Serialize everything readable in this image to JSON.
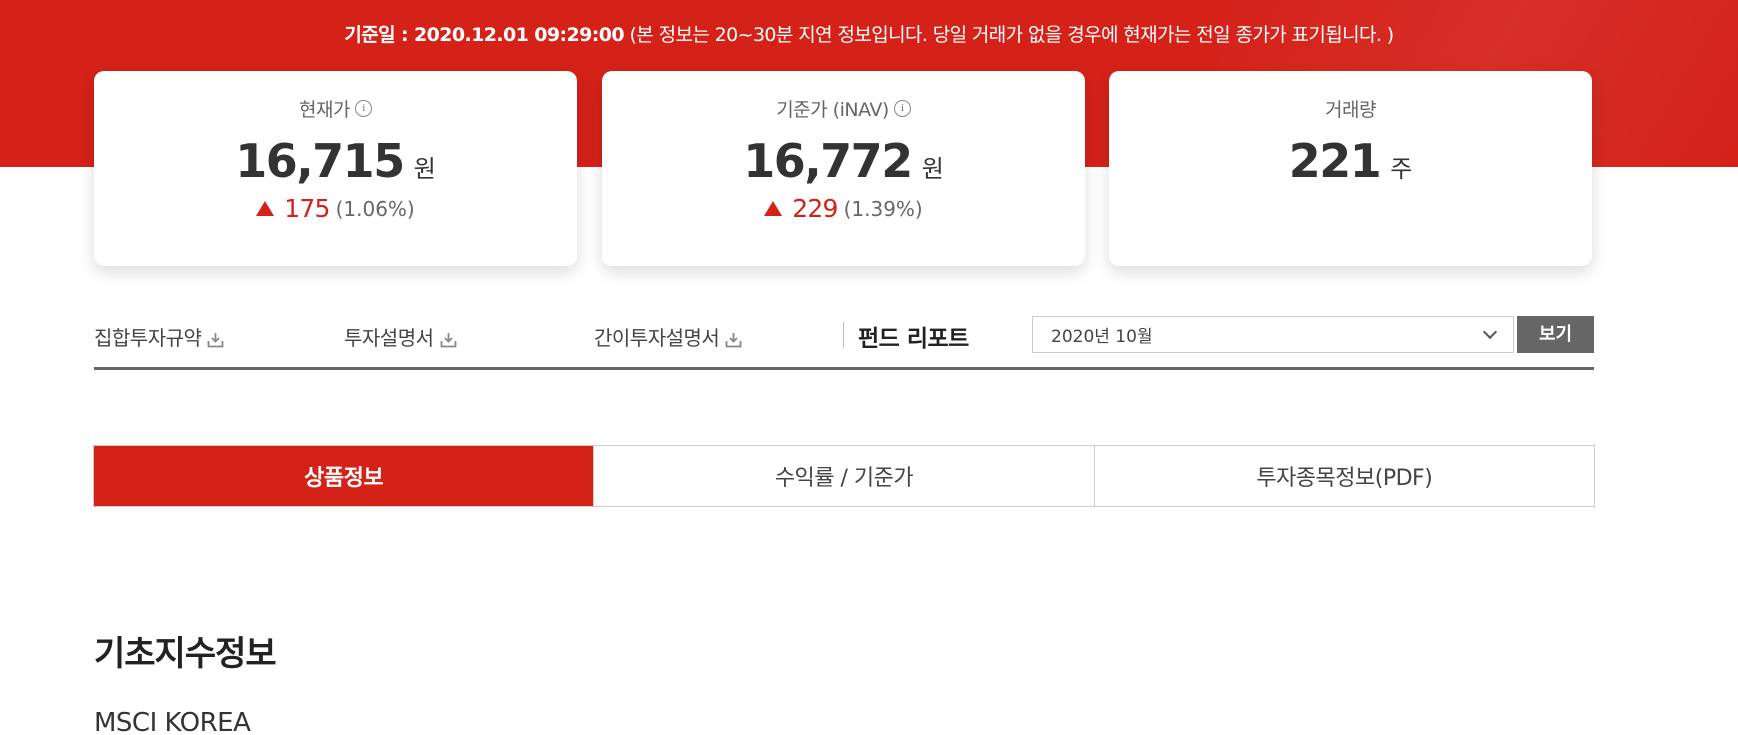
{
  "notice": {
    "date_text": "기준일 : 2020.12.01 09:29:00",
    "note_text": "(본 정보는 20~30분 지연 정보입니다. 당일 거래가 없을 경우에 현재가는 전일 종가가 표기됩니다. )"
  },
  "cards": [
    {
      "label": "현재가",
      "value": "16,715",
      "unit": "원",
      "change": "175",
      "change_pct": "(1.06%)",
      "has_info": true
    },
    {
      "label": "기준가 (iNAV)",
      "value": "16,772",
      "unit": "원",
      "change": "229",
      "change_pct": "(1.39%)",
      "has_info": true
    },
    {
      "label": "거래량",
      "value": "221",
      "unit": "주",
      "has_info": false
    }
  ],
  "docs": {
    "items": [
      "집합투자규약",
      "투자설명서",
      "간이투자설명서"
    ],
    "report_label": "펀드 리포트",
    "selected_month": "2020년 10월",
    "view_button": "보기"
  },
  "tabs": [
    {
      "label": "상품정보",
      "active": true
    },
    {
      "label": "수익률 / 기준가",
      "active": false
    },
    {
      "label": "투자종목정보(PDF)",
      "active": false
    }
  ],
  "section": {
    "title": "기초지수정보",
    "index_name": "MSCI KOREA"
  },
  "colors": {
    "accent": "#d42219",
    "button_gray": "#666666"
  },
  "icons": {
    "info": "info-circle-icon",
    "download": "download-icon",
    "select_arrow": "chevron-down-icon"
  }
}
